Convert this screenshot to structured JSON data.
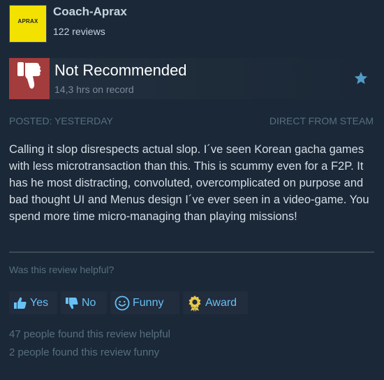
{
  "reviewer": {
    "avatar_text": "APRAX",
    "name": "Coach-Aprax",
    "review_count": "122 reviews"
  },
  "verdict": {
    "title": "Not Recommended",
    "hours": "14,3 hrs on record",
    "thumb_icon": "thumbs-down-icon",
    "thumb_bg": "#a33c3c"
  },
  "meta": {
    "posted": "Posted: yesterday",
    "source": "Direct from Steam"
  },
  "review": {
    "text": "Calling it slop disrespects actual slop. I´ve seen Korean gacha games with less microtransaction than this. This is scummy even for a F2P. It has he most distracting, convoluted, overcomplicated on purpose and bad thought UI and Menus design I´ve ever seen in a video-game. You spend more time micro-managing than playing missions!"
  },
  "helpful": {
    "question": "Was this review helpful?",
    "buttons": {
      "yes": "Yes",
      "no": "No",
      "funny": "Funny",
      "award": "Award"
    },
    "stats": {
      "helpful_text": "47 people found this review helpful",
      "funny_text": "2 people found this review funny"
    }
  },
  "colors": {
    "background": "#1b2838",
    "link": "#67c1f5",
    "muted": "#56707f",
    "award_gold": "#e9c94a"
  }
}
